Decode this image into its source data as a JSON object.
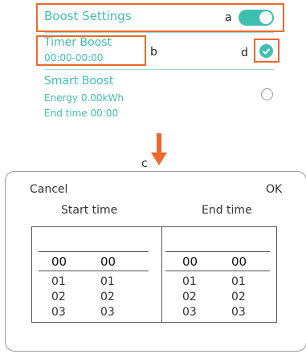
{
  "boost_settings": {
    "label": "Boost Settings",
    "annotation": "a",
    "enabled": true
  },
  "timer_boost": {
    "title": "Timer Boost",
    "time_range": "00:00-00:00",
    "annotation_title": "b",
    "annotation_check": "d",
    "selected": true
  },
  "smart_boost": {
    "title": "Smart Boost",
    "energy": "Energy 0.00kWh",
    "end_time": "End time 00:00",
    "selected": false
  },
  "arrow_annotation": "c",
  "dialog": {
    "cancel": "Cancel",
    "ok": "OK",
    "start_label": "Start time",
    "end_label": "End time",
    "start_hours": [
      "00",
      "01",
      "02",
      "03"
    ],
    "start_minutes": [
      "00",
      "01",
      "02",
      "03"
    ],
    "end_hours": [
      "00",
      "01",
      "02",
      "03"
    ],
    "end_minutes": [
      "00",
      "01",
      "02",
      "03"
    ]
  },
  "colors": {
    "accent": "#3fbfb0",
    "annotation": "#ee6a2a"
  }
}
